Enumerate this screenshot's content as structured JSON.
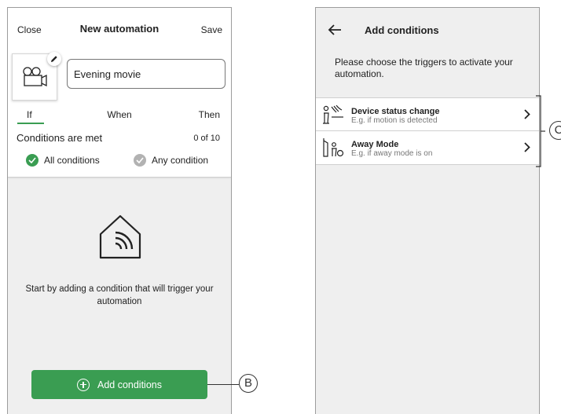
{
  "left_screen": {
    "header": {
      "close_label": "Close",
      "title": "New automation",
      "save_label": "Save"
    },
    "automation_icon": "video-camera-icon",
    "name_input": {
      "value": "Evening movie"
    },
    "tabs": [
      {
        "label": "If",
        "active": true
      },
      {
        "label": "When"
      },
      {
        "label": "Then"
      }
    ],
    "conditions": {
      "label": "Conditions are met",
      "count": "0 of 10",
      "options": [
        {
          "label": "All conditions",
          "selected": true
        },
        {
          "label": "Any condition",
          "selected": false
        }
      ]
    },
    "empty_state": {
      "icon": "smart-home-icon",
      "text": "Start by adding a condition that will trigger your automation"
    },
    "add_button": {
      "label": "Add conditions",
      "icon": "plus-circle-icon"
    }
  },
  "right_screen": {
    "header": {
      "title": "Add conditions"
    },
    "description": "Please choose the triggers to activate your automation.",
    "triggers": [
      {
        "title": "Device status change",
        "subtitle": "E.g. if motion is detected",
        "icon": "motion-sensor-icon"
      },
      {
        "title": "Away Mode",
        "subtitle": "E.g. if away mode is on",
        "icon": "away-mode-icon"
      }
    ]
  },
  "callouts": {
    "b": "B",
    "c": "C"
  },
  "colors": {
    "accent": "#3a9d52",
    "radio_off": "#b2b2b2",
    "background": "#efefef"
  }
}
